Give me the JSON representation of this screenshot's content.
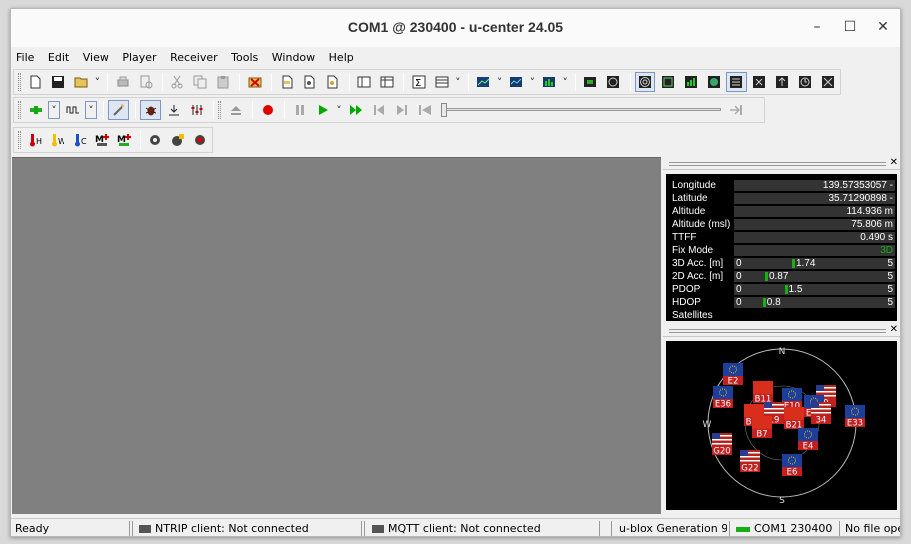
{
  "window": {
    "title": "COM1 @ 230400 - u-center 24.05"
  },
  "menu": [
    "File",
    "Edit",
    "View",
    "Player",
    "Receiver",
    "Tools",
    "Window",
    "Help"
  ],
  "dashboard": {
    "rows": [
      {
        "label": "Longitude",
        "value": "139.57353057 -"
      },
      {
        "label": "Latitude",
        "value": "35.71290898 -"
      },
      {
        "label": "Altitude",
        "value": "114.936 m"
      },
      {
        "label": "Altitude (msl)",
        "value": "75.806 m"
      },
      {
        "label": "TTFF",
        "value": "0.490 s"
      },
      {
        "label": "Fix Mode",
        "value": "3D"
      }
    ],
    "bars": [
      {
        "label": "3D Acc. [m]",
        "min": "0",
        "max": "5",
        "value": 1.74,
        "value_text": "1.74"
      },
      {
        "label": "2D Acc. [m]",
        "min": "0",
        "max": "5",
        "value": 0.87,
        "value_text": "0.87"
      },
      {
        "label": "PDOP",
        "min": "0",
        "max": "5",
        "value": 1.5,
        "value_text": "1.5"
      },
      {
        "label": "HDOP",
        "min": "0",
        "max": "5",
        "value": 0.8,
        "value_text": "0.8"
      }
    ],
    "satellites_label": "Satellites",
    "fix_color": "#16b016"
  },
  "skyview": {
    "directions": {
      "n": "N",
      "s": "S",
      "w": "W"
    },
    "satellites": [
      {
        "id": "E2",
        "flag": "eu"
      },
      {
        "id": "E36",
        "flag": "eu"
      },
      {
        "id": "B11",
        "flag": "cn"
      },
      {
        "id": "E10",
        "flag": "eu"
      },
      {
        "id": "9",
        "flag": "us"
      },
      {
        "id": "E12",
        "flag": "eu"
      },
      {
        "id": "34",
        "flag": "us"
      },
      {
        "id": "B10",
        "flag": "cn"
      },
      {
        "id": "19",
        "flag": "us"
      },
      {
        "id": "B21",
        "flag": "cn"
      },
      {
        "id": "B7",
        "flag": "cn"
      },
      {
        "id": "E33",
        "flag": "eu"
      },
      {
        "id": "E4",
        "flag": "eu"
      },
      {
        "id": "G20",
        "flag": "us"
      },
      {
        "id": "G22",
        "flag": "us"
      },
      {
        "id": "E6",
        "flag": "eu"
      }
    ]
  },
  "status": {
    "ready": "Ready",
    "ntrip": "NTRIP client: Not connected",
    "mqtt": "MQTT client: Not connected",
    "generation": "u-blox Generation 9",
    "port": "COM1 230400",
    "file": "No file open"
  },
  "colors": {
    "accent": "#16b016",
    "record": "#e00000",
    "play": "#00a800",
    "mdi_bg": "#808080"
  }
}
